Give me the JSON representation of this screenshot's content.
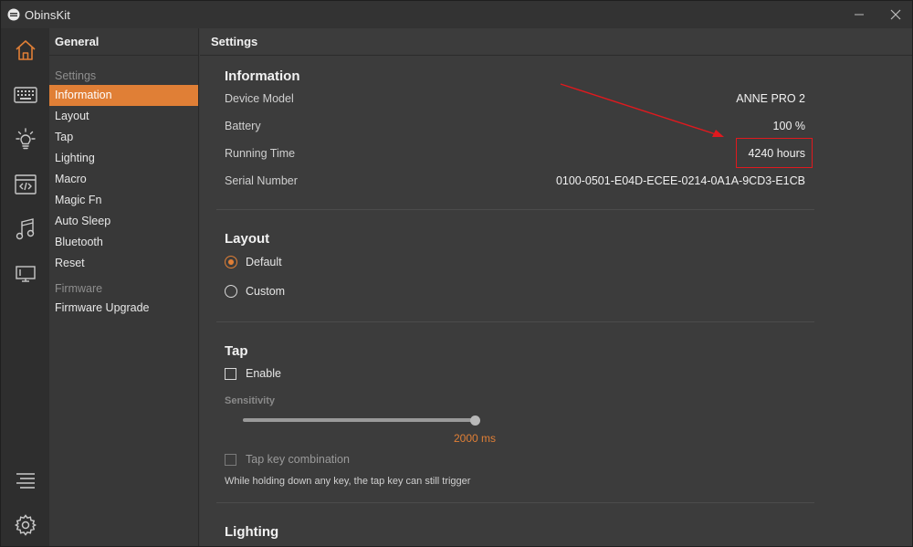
{
  "window": {
    "title": "ObinsKit"
  },
  "rail": {
    "items": [
      "home-icon",
      "keyboard-icon",
      "bulb-icon",
      "code-icon",
      "music-icon",
      "monitor-icon"
    ],
    "bottom": [
      "list-icon",
      "gear-icon"
    ],
    "accent": "#e07f36"
  },
  "sidebar": {
    "header": "General",
    "group_settings": "Settings",
    "items": [
      "Information",
      "Layout",
      "Tap",
      "Lighting",
      "Macro",
      "Magic Fn",
      "Auto Sleep",
      "Bluetooth",
      "Reset"
    ],
    "group_firmware": "Firmware",
    "firmware_items": [
      "Firmware Upgrade"
    ]
  },
  "main": {
    "header": "Settings",
    "information": {
      "title": "Information",
      "device_model_label": "Device Model",
      "device_model_value": "ANNE PRO 2",
      "battery_label": "Battery",
      "battery_value": "100 %",
      "running_time_label": "Running Time",
      "running_time_value": "4240 hours",
      "serial_label": "Serial Number",
      "serial_value": "0100-0501-E04D-ECEE-0214-0A1A-9CD3-E1CB"
    },
    "layout": {
      "title": "Layout",
      "option_default": "Default",
      "option_custom": "Custom",
      "selected": "Default"
    },
    "tap": {
      "title": "Tap",
      "enable_label": "Enable",
      "sensitivity_label": "Sensitivity",
      "sensitivity_value": "2000 ms",
      "sensitivity_fraction": 1.0,
      "combo_label": "Tap key combination",
      "combo_hint": "While holding down any key, the tap key can still trigger"
    },
    "lighting": {
      "title": "Lighting"
    }
  },
  "annotation": {
    "highlight_color": "#e0191e"
  }
}
